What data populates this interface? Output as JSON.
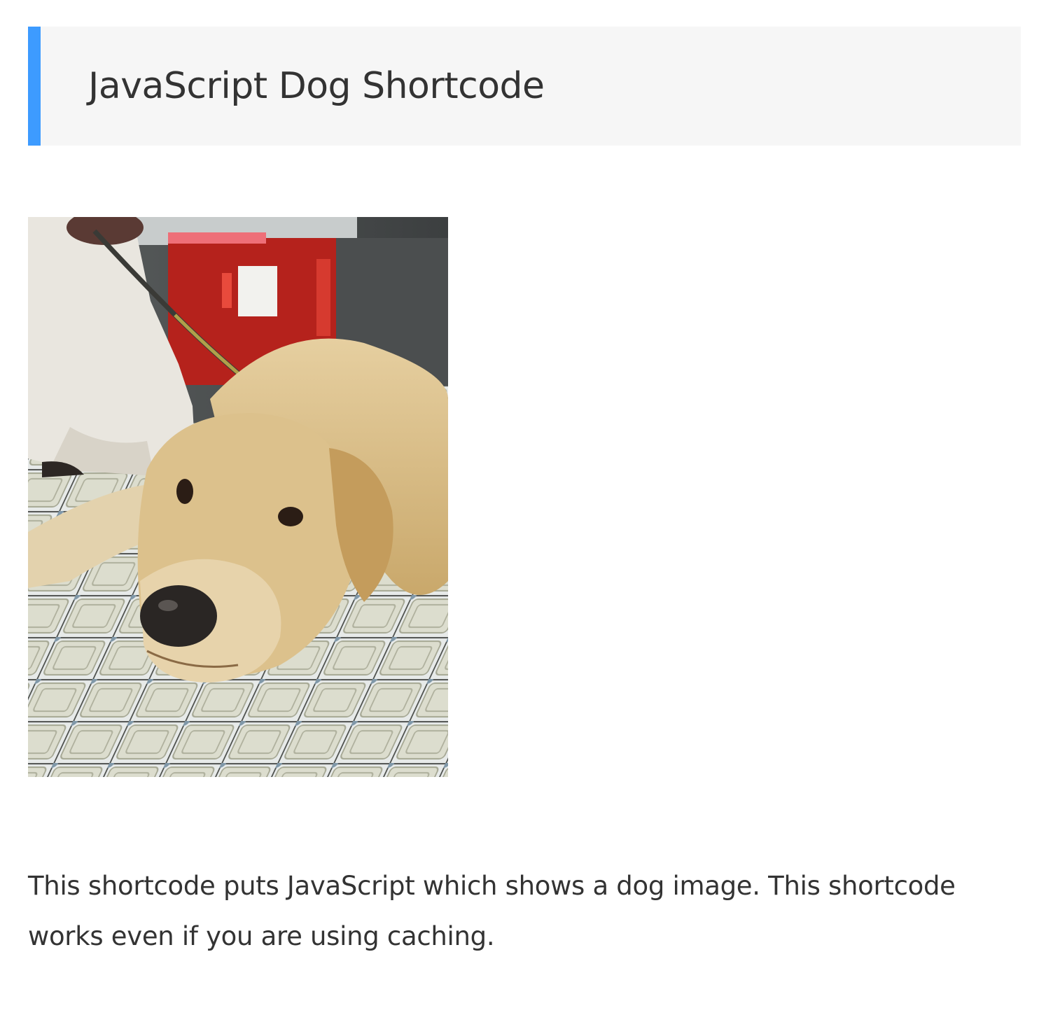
{
  "heading": {
    "title": "JavaScript Dog Shortcode"
  },
  "dog_image": {
    "icon": "dog-photo-golden-retriever"
  },
  "content": {
    "description": "This shortcode puts JavaScript which shows a dog image. This shortcode works even if you are using caching."
  },
  "colors": {
    "accent": "#3d9bff",
    "heading_background": "#f6f6f6",
    "text": "#333333",
    "page_background": "#ffffff"
  }
}
